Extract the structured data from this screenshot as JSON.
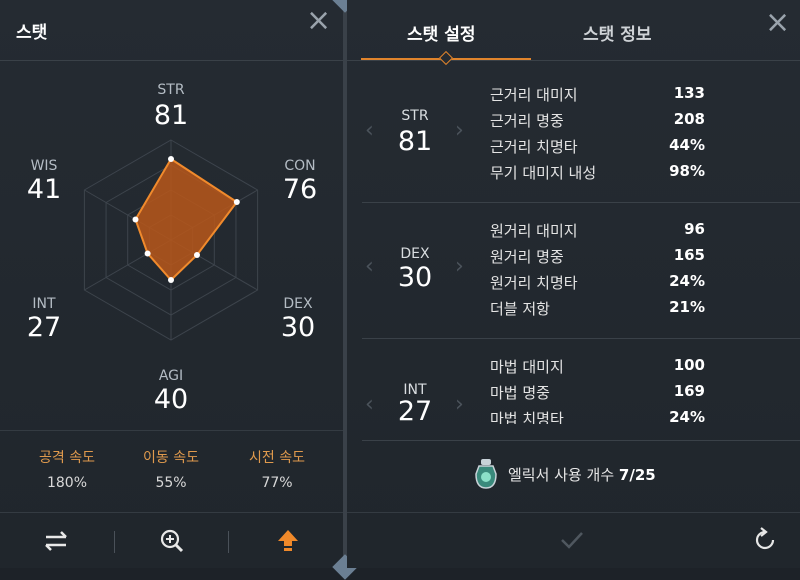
{
  "left_panel": {
    "title": "스탯",
    "stats": [
      {
        "key": "str",
        "label": "STR",
        "value": "81"
      },
      {
        "key": "con",
        "label": "CON",
        "value": "76"
      },
      {
        "key": "dex",
        "label": "DEX",
        "value": "30"
      },
      {
        "key": "agi",
        "label": "AGI",
        "value": "40"
      },
      {
        "key": "int",
        "label": "INT",
        "value": "27"
      },
      {
        "key": "wis",
        "label": "WIS",
        "value": "41"
      }
    ],
    "radar_values": {
      "STR": 81,
      "CON": 76,
      "DEX": 30,
      "AGI": 40,
      "INT": 27,
      "WIS": 41
    },
    "speeds": [
      {
        "label": "공격 속도",
        "value": "180%"
      },
      {
        "label": "이동 속도",
        "value": "55%"
      },
      {
        "label": "시전 속도",
        "value": "77%"
      }
    ],
    "bottom_icons": [
      "swap-icon",
      "zoom-in-icon",
      "stat-up-arrow-icon"
    ]
  },
  "right_panel": {
    "tabs": [
      {
        "label": "스탯 설정",
        "active": true
      },
      {
        "label": "스탯 정보",
        "active": false
      }
    ],
    "groups": [
      {
        "name": "STR",
        "value": "81",
        "rows": [
          {
            "k": "근거리 대미지",
            "v": "133"
          },
          {
            "k": "근거리 명중",
            "v": "208"
          },
          {
            "k": "근거리 치명타",
            "v": "44%"
          },
          {
            "k": "무기 대미지 내성",
            "v": "98%"
          }
        ]
      },
      {
        "name": "DEX",
        "value": "30",
        "rows": [
          {
            "k": "원거리 대미지",
            "v": "96"
          },
          {
            "k": "원거리 명중",
            "v": "165"
          },
          {
            "k": "원거리 치명타",
            "v": "24%"
          },
          {
            "k": "더블 저항",
            "v": "21%"
          }
        ]
      },
      {
        "name": "INT",
        "value": "27",
        "rows": [
          {
            "k": "마법 대미지",
            "v": "100"
          },
          {
            "k": "마법 명중",
            "v": "169"
          },
          {
            "k": "마법 치명타",
            "v": "24%"
          }
        ]
      }
    ],
    "elixir": {
      "label": "엘릭서 사용 개수",
      "count": "7/25"
    }
  },
  "colors": {
    "accent": "#e0842c",
    "radar_fill": "#b8571a",
    "radar_stroke": "#f08a2c",
    "speed_label": "#e09a4d"
  }
}
